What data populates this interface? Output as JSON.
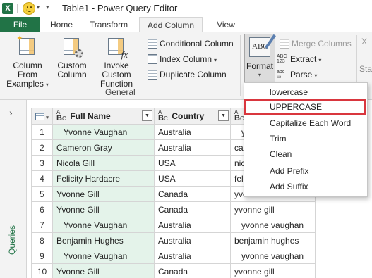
{
  "window": {
    "title": "Table1 - Power Query Editor",
    "app_icon": "excel-icon"
  },
  "tabs": [
    {
      "label": "File"
    },
    {
      "label": "Home"
    },
    {
      "label": "Transform"
    },
    {
      "label": "Add Column"
    },
    {
      "label": "View"
    }
  ],
  "ribbon": {
    "general": {
      "col_from_examples": "Column From Examples",
      "custom_column": "Custom Column",
      "invoke_custom_function": "Invoke Custom Function",
      "conditional_column": "Conditional Column",
      "index_column": "Index Column",
      "duplicate_column": "Duplicate Column",
      "group_label": "General"
    },
    "text": {
      "format": "Format",
      "merge_columns": "Merge Columns",
      "extract": "Extract",
      "parse": "Parse"
    },
    "far_right_label": "Stat"
  },
  "queries_pane": {
    "label": "Queries"
  },
  "table": {
    "columns": [
      {
        "name": "Full Name",
        "type": "ABC"
      },
      {
        "name": "Country",
        "type": "ABC"
      },
      {
        "name": "",
        "type": "ABC"
      }
    ],
    "rows": [
      {
        "num": "1",
        "full_name": "   Yvonne Vaughan",
        "country": "Australia",
        "third": "   y"
      },
      {
        "num": "2",
        "full_name": "Cameron Gray",
        "country": "Australia",
        "third": "cam"
      },
      {
        "num": "3",
        "full_name": "Nicola Gill",
        "country": "USA",
        "third": "nico"
      },
      {
        "num": "4",
        "full_name": "Felicity Hardacre",
        "country": "USA",
        "third": "felic"
      },
      {
        "num": "5",
        "full_name": "Yvonne Gill",
        "country": "Canada",
        "third": "yvo"
      },
      {
        "num": "6",
        "full_name": "Yvonne Gill",
        "country": "Canada",
        "third": "yvonne gill"
      },
      {
        "num": "7",
        "full_name": "   Yvonne Vaughan",
        "country": "Australia",
        "third": "   yvonne vaughan"
      },
      {
        "num": "8",
        "full_name": "Benjamin Hughes",
        "country": "Australia",
        "third": "benjamin hughes"
      },
      {
        "num": "9",
        "full_name": "   Yvonne Vaughan",
        "country": "Australia",
        "third": "   yvonne vaughan"
      },
      {
        "num": "10",
        "full_name": "Yvonne Gill",
        "country": "Canada",
        "third": "yvonne gill"
      }
    ]
  },
  "format_menu": {
    "items": [
      "lowercase",
      "UPPERCASE",
      "Capitalize Each Word",
      "Trim",
      "Clean",
      "Add Prefix",
      "Add Suffix"
    ],
    "highlighted": "UPPERCASE"
  },
  "colors": {
    "accent": "#217346",
    "highlight_border": "#d9363e",
    "selected_column": "#e4f3ea"
  }
}
